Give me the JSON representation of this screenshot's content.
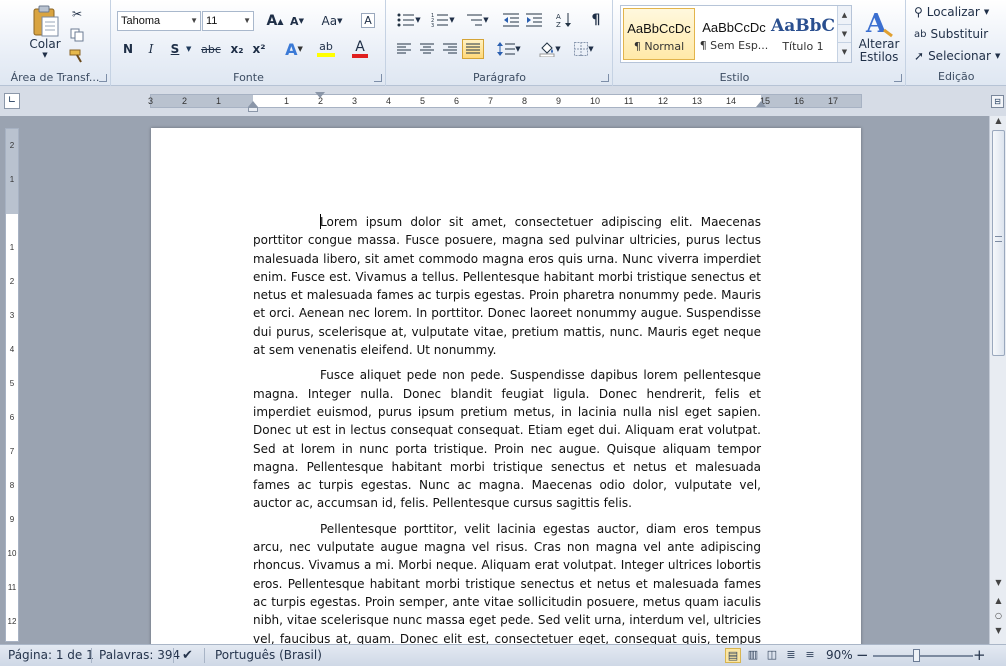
{
  "ribbon": {
    "clipboard": {
      "label": "Área de Transf...",
      "paste_label": "Colar",
      "cut_icon": "scissors-icon",
      "copy_icon": "copy-icon",
      "format_painter_icon": "brush-icon"
    },
    "font": {
      "label": "Fonte",
      "font_name": "Tahoma",
      "font_size": "11",
      "bold": "N",
      "italic": "I",
      "underline": "S",
      "strike": "abc",
      "subscript": "x₂",
      "superscript": "x²",
      "grow": "A",
      "shrink": "A",
      "case": "Aa",
      "effects": "A",
      "highlight": "ab",
      "font_color": "A"
    },
    "paragraph": {
      "label": "Parágrafo",
      "pilcrow": "¶"
    },
    "styles": {
      "label": "Estilo",
      "items": [
        {
          "preview": "AaBbCcDc",
          "name": "¶ Normal"
        },
        {
          "preview": "AaBbCcDc",
          "name": "¶ Sem Esp..."
        },
        {
          "preview": "AaBbC",
          "name": "Título 1"
        }
      ],
      "change_styles_l1": "Alterar",
      "change_styles_l2": "Estilos"
    },
    "editing": {
      "label": "Edição",
      "find": "Localizar",
      "replace": "Substituir",
      "select": "Selecionar"
    }
  },
  "ruler": {
    "h_ticks": [
      "3",
      "2",
      "1",
      "1",
      "2",
      "3",
      "4",
      "5",
      "6",
      "7",
      "8",
      "9",
      "10",
      "11",
      "12",
      "13",
      "14",
      "15",
      "16",
      "17"
    ],
    "v_ticks": [
      "2",
      "1",
      "1",
      "2",
      "3",
      "4",
      "5",
      "6",
      "7",
      "8",
      "9",
      "10",
      "11",
      "12"
    ]
  },
  "document": {
    "paragraphs": [
      "Lorem ipsum dolor sit amet, consectetuer adipiscing elit. Maecenas porttitor congue massa. Fusce posuere, magna sed pulvinar ultricies, purus lectus malesuada libero, sit amet commodo magna eros quis urna. Nunc viverra imperdiet enim. Fusce est. Vivamus a tellus. Pellentesque habitant morbi tristique senectus et netus et malesuada fames ac turpis egestas. Proin pharetra nonummy pede. Mauris et orci. Aenean nec lorem. In porttitor. Donec laoreet nonummy augue. Suspendisse dui purus, scelerisque at, vulputate vitae, pretium mattis, nunc. Mauris eget neque at sem venenatis eleifend. Ut nonummy.",
      "Fusce aliquet pede non pede. Suspendisse dapibus lorem pellentesque magna. Integer nulla. Donec blandit feugiat ligula. Donec hendrerit, felis et imperdiet euismod, purus ipsum pretium metus, in lacinia nulla nisl eget sapien. Donec ut est in lectus consequat consequat. Etiam eget dui. Aliquam erat volutpat. Sed at lorem in nunc porta tristique. Proin nec augue. Quisque aliquam tempor magna. Pellentesque habitant morbi tristique senectus et netus et malesuada fames ac turpis egestas. Nunc ac magna. Maecenas odio dolor, vulputate vel, auctor ac, accumsan id, felis. Pellentesque cursus sagittis felis.",
      "Pellentesque porttitor, velit lacinia egestas auctor, diam eros tempus arcu, nec vulputate augue magna vel risus. Cras non magna vel ante adipiscing rhoncus. Vivamus a mi. Morbi neque. Aliquam erat volutpat. Integer ultrices lobortis eros. Pellentesque habitant morbi tristique senectus et netus et malesuada fames ac turpis egestas. Proin semper, ante vitae sollicitudin posuere, metus quam iaculis nibh, vitae scelerisque nunc massa eget pede. Sed velit urna, interdum vel, ultricies vel, faucibus at, quam. Donec elit est, consectetuer eget, consequat quis, tempus quis, wisi. In in"
    ]
  },
  "status": {
    "page": "Página: 1 de 1",
    "words": "Palavras: 394",
    "language": "Português (Brasil)",
    "zoom": "90%",
    "zoom_minus": "−",
    "zoom_plus": "+"
  }
}
